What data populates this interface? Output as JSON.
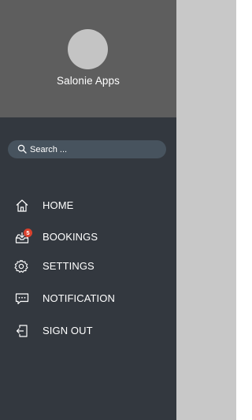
{
  "profile": {
    "name": "Salonie Apps"
  },
  "search": {
    "placeholder": "Search ...",
    "value": ""
  },
  "menu": {
    "items": [
      {
        "label": "HOME",
        "icon": "home-icon"
      },
      {
        "label": "BOOKINGS",
        "icon": "bookings-inbox-icon",
        "badge": "5"
      },
      {
        "label": "SETTINGS",
        "icon": "gear-icon"
      },
      {
        "label": "NOTIFICATION",
        "icon": "chat-notification-icon"
      },
      {
        "label": "SIGN OUT",
        "icon": "sign-out-icon"
      }
    ]
  },
  "colors": {
    "drawer_bg": "#33383f",
    "profile_bg": "#5e5e5e",
    "search_bg": "#47535e",
    "badge": "#d9412d",
    "backdrop": "#c8c8c8"
  }
}
